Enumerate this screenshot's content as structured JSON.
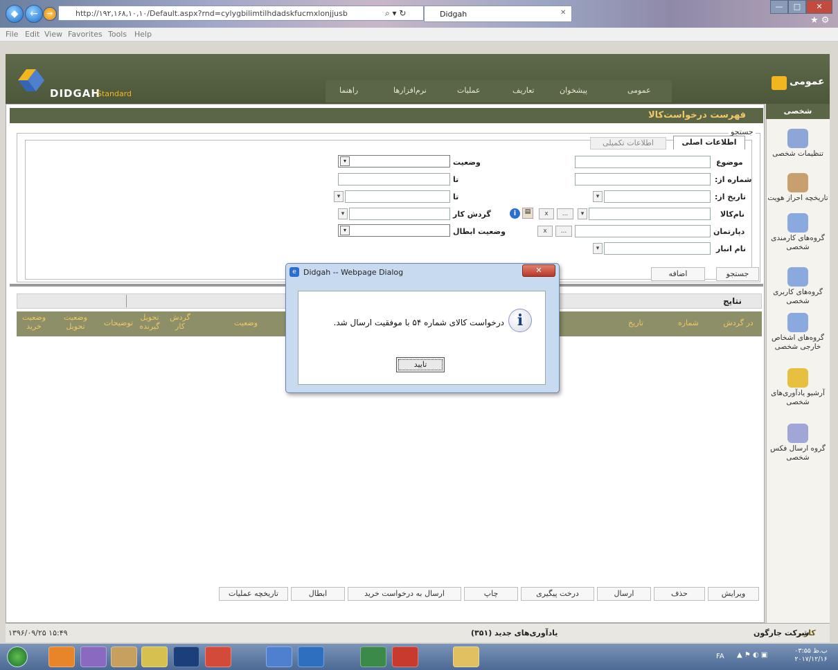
{
  "browser": {
    "address": "http://۱۹۲,۱۶۸,۱۰,۱۰/Default.aspx?rnd=cylygbilimtilhdadskfucmxlonjjusb",
    "tab_title": "Didgah",
    "menu": [
      "File",
      "Edit",
      "View",
      "Favorites",
      "Tools",
      "Help"
    ]
  },
  "app": {
    "logo_text": "DIDGAH",
    "logo_sub": "Standard",
    "section_title": "عمومی",
    "nav_tabs": [
      "راهنما",
      "نرم‌افزارها",
      "عملیات",
      "تعاریف",
      "پیشخوان",
      "عمومی"
    ]
  },
  "page": {
    "title": "فهرست درخواست‌کالا",
    "search_legend": "جستجو",
    "tabs": {
      "main": "اطلاعات اصلی",
      "extra": "اطلاعات تکمیلی"
    },
    "labels": {
      "subject": "موضوع",
      "number_from": "شماره از:",
      "date_from": "تاریخ از:",
      "item_name": "نام‌کالا",
      "department": "دپارتمان",
      "warehouse": "نام انبار",
      "status": "وضعیت",
      "to1": "تا",
      "to2": "تا",
      "workflow": "گردش کار",
      "cancel_status": "وضعیت ابطال"
    },
    "search_btn": "جستجو",
    "add_btn": "اضافه",
    "results_title": "نتایج",
    "columns": [
      "در گردش",
      "شماره",
      "تاریخ",
      "وضعیت",
      "گردش کار",
      "تحویل گیرنده",
      "توضیحات",
      "وضعیت تحویل",
      "وضعیت خرید"
    ]
  },
  "sidebar": {
    "title": "شخصی",
    "items": [
      {
        "label": "تنظیمات شخصی",
        "color": "#7a8fc8"
      },
      {
        "label": "تاریخچه احراز هویت",
        "color": "#c08a5a"
      },
      {
        "label": "گروه‌های کارمندی شخصی",
        "color": "#6a8fd0"
      },
      {
        "label": "گروه‌های کاربری شخصی",
        "color": "#6a8fd0"
      },
      {
        "label": "گروه‌های اشخاص خارجی شخصی",
        "color": "#6a8fd0"
      },
      {
        "label": "آرشیو یادآوری‌های شخصی",
        "color": "#e0b020"
      },
      {
        "label": "گروه ارسال فکس شخصی",
        "color": "#8a8fc8"
      }
    ]
  },
  "actions": [
    "ویرایش",
    "حذف",
    "ارسال",
    "درخت پیگیری",
    "چاپ",
    "ارسال به درخواست خرید",
    "ابطال",
    "تاریخچه عملیات"
  ],
  "dialog": {
    "title": "Didgah -- Webpage Dialog",
    "message": "درخواست کالای شماره ۵۴ با موفقیت ارسال شد.",
    "ok": "تایید"
  },
  "status": {
    "user_label": "کاربر",
    "user": "شرکت جارگون",
    "reminders": "یادآوری‌های جدید (۳۵۱)",
    "datetime": "۱۳۹۶/۰۹/۲۵ ۱۵:۴۹"
  },
  "taskbar": {
    "lang": "FA",
    "time": "۰۳:۵۵ ب.ظ",
    "date": "۲۰۱۷/۱۲/۱۶"
  }
}
